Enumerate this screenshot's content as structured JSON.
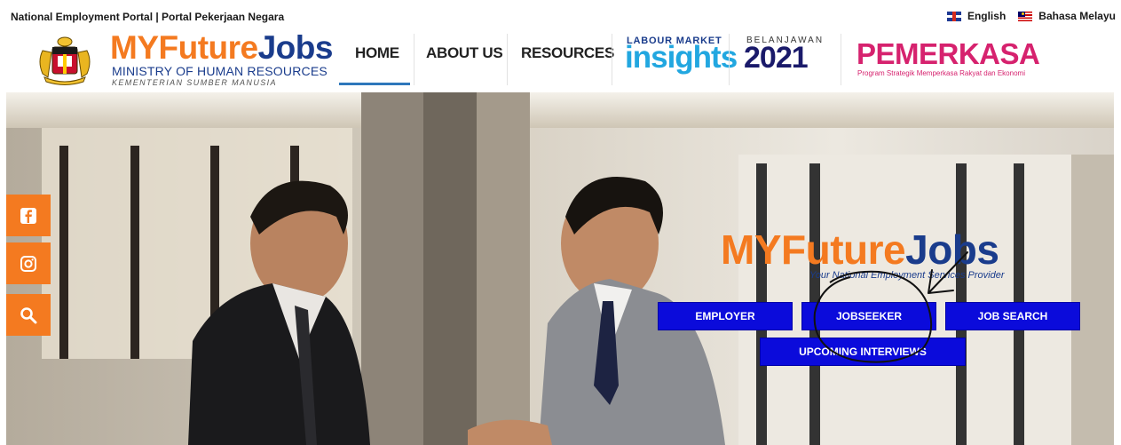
{
  "topbar": {
    "portal_title": "National Employment Portal | Portal Pekerjaan Negara",
    "languages": [
      {
        "label": "English",
        "flag": "uk-flag"
      },
      {
        "label": "Bahasa Melayu",
        "flag": "malaysia-flag"
      }
    ]
  },
  "header": {
    "logo": {
      "prefix": "MYFuture",
      "suffix": "Jobs",
      "ministry": "MINISTRY OF HUMAN RESOURCES",
      "ministry_ms": "KEMENTERIAN SUMBER MANUSIA"
    },
    "nav": [
      {
        "label": "HOME",
        "active": true
      },
      {
        "label": "ABOUT US",
        "active": false
      },
      {
        "label": "RESOURCES",
        "active": false
      }
    ],
    "partners": {
      "lmi_small": "LABOUR MARKET",
      "lmi_big": "insights",
      "belanjawan_small": "BELANJAWAN",
      "belanjawan_big": "2021",
      "pemerkasa": "PEMERKASA",
      "pemerkasa_sub": "Program Strategik Memperkasa Rakyat dan Ekonomi"
    }
  },
  "hero": {
    "logo_prefix": "MYFuture",
    "logo_suffix": "Jobs",
    "tagline": "Your National Employment Services Provider",
    "buttons": {
      "employer": "EMPLOYER",
      "jobseeker": "JOBSEEKER",
      "job_search": "JOB SEARCH",
      "upcoming_interviews": "UPCOMING INTERVIEWS"
    }
  },
  "social": [
    "facebook-icon",
    "instagram-icon",
    "search-icon"
  ],
  "colors": {
    "brand_orange": "#f47a20",
    "brand_navy": "#1a3c8c",
    "hero_button": "#0b0bdb",
    "nav_active": "#2e77bb",
    "pemerkasa": "#d6226e"
  }
}
